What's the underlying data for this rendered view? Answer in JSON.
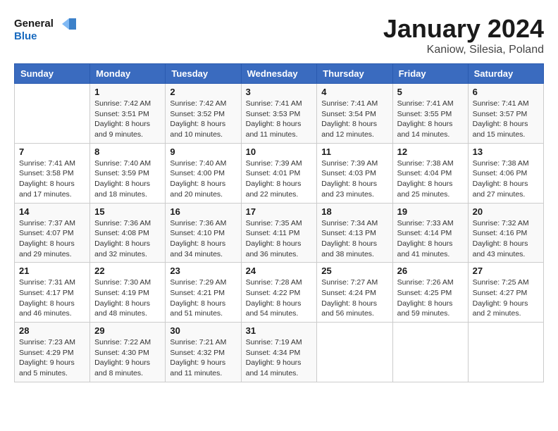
{
  "header": {
    "logo_line1": "General",
    "logo_line2": "Blue",
    "month": "January 2024",
    "location": "Kaniow, Silesia, Poland"
  },
  "weekdays": [
    "Sunday",
    "Monday",
    "Tuesday",
    "Wednesday",
    "Thursday",
    "Friday",
    "Saturday"
  ],
  "weeks": [
    [
      {
        "day": "",
        "info": ""
      },
      {
        "day": "1",
        "info": "Sunrise: 7:42 AM\nSunset: 3:51 PM\nDaylight: 8 hours\nand 9 minutes."
      },
      {
        "day": "2",
        "info": "Sunrise: 7:42 AM\nSunset: 3:52 PM\nDaylight: 8 hours\nand 10 minutes."
      },
      {
        "day": "3",
        "info": "Sunrise: 7:41 AM\nSunset: 3:53 PM\nDaylight: 8 hours\nand 11 minutes."
      },
      {
        "day": "4",
        "info": "Sunrise: 7:41 AM\nSunset: 3:54 PM\nDaylight: 8 hours\nand 12 minutes."
      },
      {
        "day": "5",
        "info": "Sunrise: 7:41 AM\nSunset: 3:55 PM\nDaylight: 8 hours\nand 14 minutes."
      },
      {
        "day": "6",
        "info": "Sunrise: 7:41 AM\nSunset: 3:57 PM\nDaylight: 8 hours\nand 15 minutes."
      }
    ],
    [
      {
        "day": "7",
        "info": "Sunrise: 7:41 AM\nSunset: 3:58 PM\nDaylight: 8 hours\nand 17 minutes."
      },
      {
        "day": "8",
        "info": "Sunrise: 7:40 AM\nSunset: 3:59 PM\nDaylight: 8 hours\nand 18 minutes."
      },
      {
        "day": "9",
        "info": "Sunrise: 7:40 AM\nSunset: 4:00 PM\nDaylight: 8 hours\nand 20 minutes."
      },
      {
        "day": "10",
        "info": "Sunrise: 7:39 AM\nSunset: 4:01 PM\nDaylight: 8 hours\nand 22 minutes."
      },
      {
        "day": "11",
        "info": "Sunrise: 7:39 AM\nSunset: 4:03 PM\nDaylight: 8 hours\nand 23 minutes."
      },
      {
        "day": "12",
        "info": "Sunrise: 7:38 AM\nSunset: 4:04 PM\nDaylight: 8 hours\nand 25 minutes."
      },
      {
        "day": "13",
        "info": "Sunrise: 7:38 AM\nSunset: 4:06 PM\nDaylight: 8 hours\nand 27 minutes."
      }
    ],
    [
      {
        "day": "14",
        "info": "Sunrise: 7:37 AM\nSunset: 4:07 PM\nDaylight: 8 hours\nand 29 minutes."
      },
      {
        "day": "15",
        "info": "Sunrise: 7:36 AM\nSunset: 4:08 PM\nDaylight: 8 hours\nand 32 minutes."
      },
      {
        "day": "16",
        "info": "Sunrise: 7:36 AM\nSunset: 4:10 PM\nDaylight: 8 hours\nand 34 minutes."
      },
      {
        "day": "17",
        "info": "Sunrise: 7:35 AM\nSunset: 4:11 PM\nDaylight: 8 hours\nand 36 minutes."
      },
      {
        "day": "18",
        "info": "Sunrise: 7:34 AM\nSunset: 4:13 PM\nDaylight: 8 hours\nand 38 minutes."
      },
      {
        "day": "19",
        "info": "Sunrise: 7:33 AM\nSunset: 4:14 PM\nDaylight: 8 hours\nand 41 minutes."
      },
      {
        "day": "20",
        "info": "Sunrise: 7:32 AM\nSunset: 4:16 PM\nDaylight: 8 hours\nand 43 minutes."
      }
    ],
    [
      {
        "day": "21",
        "info": "Sunrise: 7:31 AM\nSunset: 4:17 PM\nDaylight: 8 hours\nand 46 minutes."
      },
      {
        "day": "22",
        "info": "Sunrise: 7:30 AM\nSunset: 4:19 PM\nDaylight: 8 hours\nand 48 minutes."
      },
      {
        "day": "23",
        "info": "Sunrise: 7:29 AM\nSunset: 4:21 PM\nDaylight: 8 hours\nand 51 minutes."
      },
      {
        "day": "24",
        "info": "Sunrise: 7:28 AM\nSunset: 4:22 PM\nDaylight: 8 hours\nand 54 minutes."
      },
      {
        "day": "25",
        "info": "Sunrise: 7:27 AM\nSunset: 4:24 PM\nDaylight: 8 hours\nand 56 minutes."
      },
      {
        "day": "26",
        "info": "Sunrise: 7:26 AM\nSunset: 4:25 PM\nDaylight: 8 hours\nand 59 minutes."
      },
      {
        "day": "27",
        "info": "Sunrise: 7:25 AM\nSunset: 4:27 PM\nDaylight: 9 hours\nand 2 minutes."
      }
    ],
    [
      {
        "day": "28",
        "info": "Sunrise: 7:23 AM\nSunset: 4:29 PM\nDaylight: 9 hours\nand 5 minutes."
      },
      {
        "day": "29",
        "info": "Sunrise: 7:22 AM\nSunset: 4:30 PM\nDaylight: 9 hours\nand 8 minutes."
      },
      {
        "day": "30",
        "info": "Sunrise: 7:21 AM\nSunset: 4:32 PM\nDaylight: 9 hours\nand 11 minutes."
      },
      {
        "day": "31",
        "info": "Sunrise: 7:19 AM\nSunset: 4:34 PM\nDaylight: 9 hours\nand 14 minutes."
      },
      {
        "day": "",
        "info": ""
      },
      {
        "day": "",
        "info": ""
      },
      {
        "day": "",
        "info": ""
      }
    ]
  ]
}
